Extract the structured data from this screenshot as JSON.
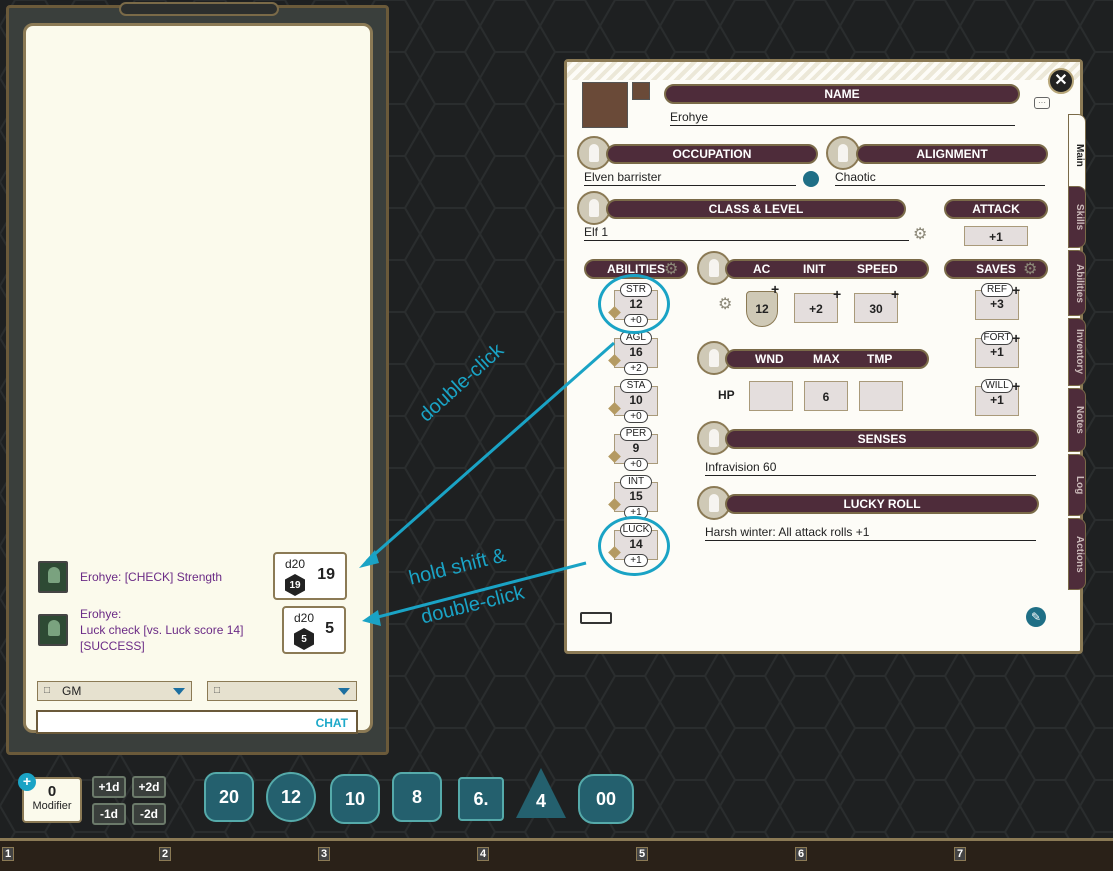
{
  "chat": {
    "messages": [
      {
        "text": "Erohye:   [CHECK] Strength",
        "die": "d20",
        "face": "19",
        "result": "19"
      },
      {
        "line1": "Erohye:",
        "line2": "Luck check [vs. Luck score 14]",
        "line3": "[SUCCESS]",
        "die": "d20",
        "face": "5",
        "result": "5"
      }
    ],
    "identity_select": "GM",
    "mode_select": "",
    "send_label": "CHAT"
  },
  "dice_bar": {
    "modifier_value": "0",
    "modifier_label": "Modifier",
    "buttons": [
      "+1d",
      "+2d",
      "-1d",
      "-2d"
    ],
    "dice": [
      "20",
      "12",
      "10",
      "8",
      "6.",
      "4",
      "00"
    ]
  },
  "hotbar": {
    "slots": [
      "1",
      "2",
      "3",
      "4",
      "5",
      "6",
      "7"
    ]
  },
  "sheet": {
    "name_label": "NAME",
    "name": "Erohye",
    "occupation_label": "OCCUPATION",
    "occupation": "Elven barrister",
    "alignment_label": "ALIGNMENT",
    "alignment": "Chaotic",
    "class_label": "CLASS & LEVEL",
    "class": "Elf 1",
    "attack_label": "ATTACK",
    "attack": "+1",
    "abilities_label": "ABILITIES",
    "abilities": [
      {
        "abbr": "STR",
        "score": "12",
        "mod": "+0"
      },
      {
        "abbr": "AGL",
        "score": "16",
        "mod": "+2"
      },
      {
        "abbr": "STA",
        "score": "10",
        "mod": "+0"
      },
      {
        "abbr": "PER",
        "score": "9",
        "mod": "+0"
      },
      {
        "abbr": "INT",
        "score": "15",
        "mod": "+1"
      },
      {
        "abbr": "LUCK",
        "score": "14",
        "mod": "+1"
      }
    ],
    "combat": {
      "ac_label": "AC",
      "init_label": "INIT",
      "speed_label": "SPEED",
      "ac": "12",
      "init": "+2",
      "speed": "30"
    },
    "saves_label": "SAVES",
    "saves": [
      {
        "abbr": "REF",
        "value": "+3"
      },
      {
        "abbr": "FORT",
        "value": "+1"
      },
      {
        "abbr": "WILL",
        "value": "+1"
      }
    ],
    "hp": {
      "wnd_label": "WND",
      "max_label": "MAX",
      "tmp_label": "TMP",
      "hp_label": "HP",
      "wnd": "",
      "max": "6",
      "tmp": ""
    },
    "senses_label": "SENSES",
    "senses": "Infravision 60",
    "lucky_label": "LUCKY ROLL",
    "lucky": "Harsh winter: All attack rolls +1",
    "tabs": [
      "Main",
      "Skills",
      "Abilities",
      "Inventory",
      "Notes",
      "Log",
      "Actions"
    ]
  },
  "annotations": {
    "a1": "double-click",
    "a2_line1": "hold shift &",
    "a2_line2": "double-click"
  },
  "colors": {
    "accent": "#1aa3c5",
    "header": "#4e2c3a",
    "frame": "#8b7a55"
  }
}
